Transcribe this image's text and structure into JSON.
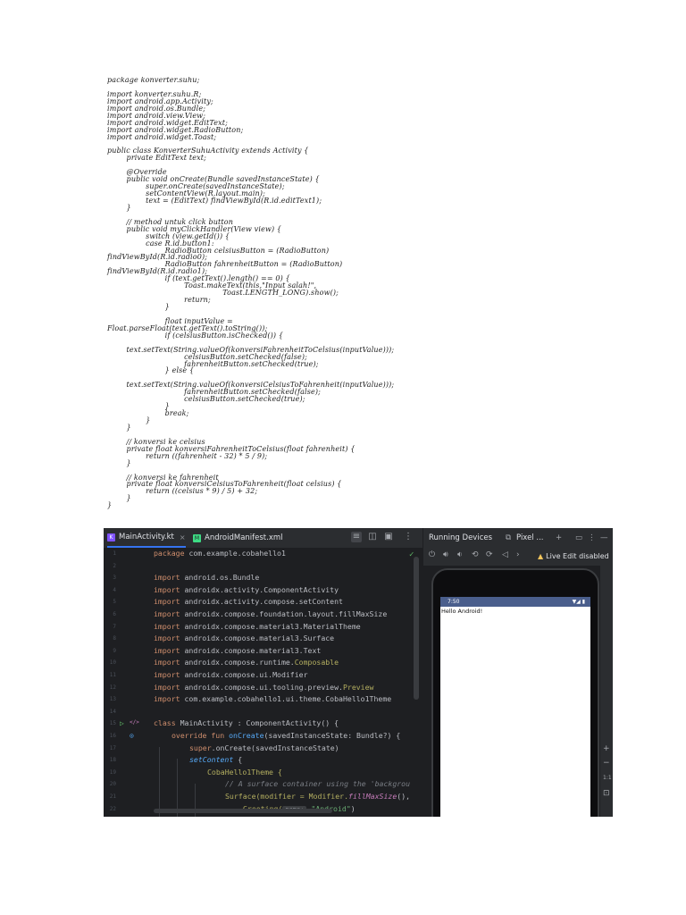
{
  "print_code": [
    "package konverter.suhu;",
    "",
    "import konverter.suhu.R;",
    "import android.app.Activity;",
    "import android.os.Bundle;",
    "import android.view.View;",
    "import android.widget.EditText;",
    "import android.widget.RadioButton;",
    "import android.widget.Toast;",
    "",
    "public class KonverterSuhuActivity extends Activity {",
    "        private EditText text;",
    "",
    "        @Override",
    "        public void onCreate(Bundle savedInstanceState) {",
    "                super.onCreate(savedInstanceState);",
    "                setContentView(R.layout.main);",
    "                text = (EditText) findViewById(R.id.editText1);",
    "        }",
    "",
    "        // method untuk click button",
    "        public void myClickHandler(View view) {",
    "                switch (view.getId()) {",
    "                case R.id.button1:",
    "                        RadioButton celsiusButton = (RadioButton)",
    "findViewById(R.id.radio0);",
    "                        RadioButton fahrenheitButton = (RadioButton)",
    "findViewById(R.id.radio1);",
    "                        if (text.getText().length() == 0) {",
    "                                Toast.makeText(this,\"Input salah!\",",
    "                                                Toast.LENGTH_LONG).show();",
    "                                return;",
    "                        }",
    "",
    "                        float inputValue =",
    "Float.parseFloat(text.getText().toString());",
    "                        if (celsiusButton.isChecked()) {",
    "",
    "        text.setText(String.valueOf(konversiFahrenheitToCelsius(inputValue)));",
    "                                celsiusButton.setChecked(false);",
    "                                fahrenheitButton.setChecked(true);",
    "                        } else {",
    "",
    "        text.setText(String.valueOf(konversiCelsiusToFahrenheit(inputValue)));",
    "                                fahrenheitButton.setChecked(false);",
    "                                celsiusButton.setChecked(true);",
    "                        }",
    "                        break;",
    "                }",
    "        }",
    "",
    "        // konversi ke celsius",
    "        private float konversiFahrenheitToCelsius(float fahrenheit) {",
    "                return ((fahrenheit - 32) * 5 / 9);",
    "        }",
    "",
    "        // konversi ke fahrenheit",
    "        private float konversiCelsiusToFahrenheit(float celsius) {",
    "                return ((celsius * 9) / 5) + 32;",
    "        }",
    "}"
  ],
  "editor": {
    "tabs": [
      {
        "label": "MainActivity.kt",
        "icon": "kotlin-file-icon",
        "active": true
      },
      {
        "label": "AndroidManifest.xml",
        "icon": "manifest-file-icon",
        "active": false
      }
    ],
    "line_numbers": [
      "1",
      "2",
      "3",
      "4",
      "5",
      "6",
      "7",
      "8",
      "9",
      "10",
      "11",
      "12",
      "13",
      "14",
      "15",
      "16",
      "17",
      "18",
      "19",
      "20",
      "21",
      "22"
    ],
    "lines": {
      "l1_pkg": "package",
      "l1_name": " com.example.cobahello1",
      "imp": "import",
      "l3": " android.os.Bundle",
      "l4": " androidx.activity.ComponentActivity",
      "l5": " androidx.activity.compose.setContent",
      "l6": " androidx.compose.foundation.layout.fillMaxSize",
      "l7": " androidx.compose.material3.MaterialTheme",
      "l8": " androidx.compose.material3.Surface",
      "l9": " androidx.compose.material3.Text",
      "l10a": " androidx.compose.runtime.",
      "l10b": "Composable",
      "l11": " androidx.compose.ui.Modifier",
      "l12a": " androidx.compose.ui.tooling.preview.",
      "l12b": "Preview",
      "l13": " com.example.cobahello1.ui.theme.CobaHello1Theme",
      "l15a": "class",
      "l15b": " MainActivity : ComponentActivity() {",
      "l16a": "override fun ",
      "l16b": "onCreate",
      "l16c": "(savedInstanceState: Bundle?) {",
      "l17a": "super",
      "l17b": ".onCreate(savedInstanceState)",
      "l18a": "setContent",
      "l18b": " {",
      "l19": "CobaHello1Theme {",
      "l20": "// A surface container using the 'backgrou",
      "l21a": "Surface(modifier = Modifier.",
      "l21b": "fillMaxSize",
      "l21c": "(),",
      "l22a": "Greeting(",
      "l22hint": "name:",
      "l22str": "\"Android\"",
      "l22c": ")"
    }
  },
  "devices": {
    "title": "Running Devices",
    "device_tab": "Pixel ...",
    "live_edit": "Live Edit disabled",
    "status_time": "7:50",
    "status_right": "▼◢ ▮",
    "greeting_text": "Hello Android!",
    "zoom_label": "1:1"
  },
  "colors": {
    "ide_background": "#1e1f22",
    "accent": "#3574f0",
    "keyword": "#cf8e6d",
    "status_bar": "#4a5e8c"
  }
}
